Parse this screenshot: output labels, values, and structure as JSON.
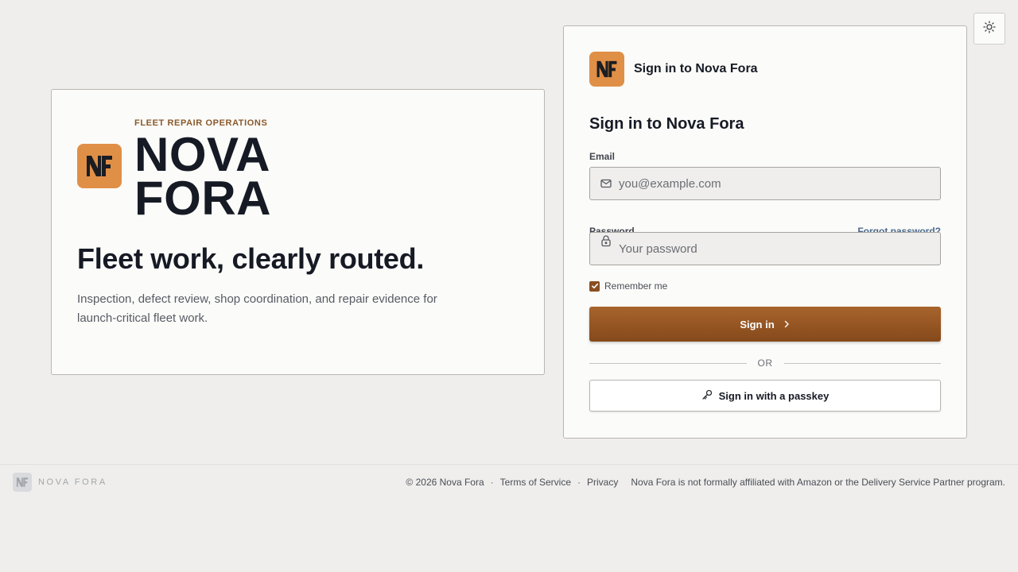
{
  "brand": {
    "eyebrow": "FLEET REPAIR OPERATIONS",
    "name_line1": "NOVA",
    "name_line2": "FORA",
    "logo_text": "NF",
    "accent_color": "#e08f47"
  },
  "hero": {
    "headline": "Fleet work, clearly routed.",
    "tagline": "Inspection, defect review, shop coordination, and repair evidence for launch-critical fleet work."
  },
  "signin": {
    "header_title": "Sign in to Nova Fora",
    "form_title": "Sign in to Nova Fora",
    "email_label": "Email",
    "email_placeholder": "you@example.com",
    "email_value": "",
    "password_label": "Password",
    "password_placeholder": "Your password",
    "password_value": "",
    "forgot_label": "Forgot password?",
    "remember_label": "Remember me",
    "remember_checked": true,
    "submit_label": "Sign in",
    "divider_label": "OR",
    "passkey_label": "Sign in with a passkey",
    "button_color": "#9a5a25"
  },
  "footer": {
    "brand_name": "NOVA FORA",
    "copyright": "© 2026 Nova Fora",
    "terms_label": "Terms of Service",
    "privacy_label": "Privacy",
    "separator": "·",
    "disclaimer": "Nova Fora is not formally affiliated with Amazon or the Delivery Service Partner program."
  },
  "icons": {
    "theme_toggle": "sun-icon",
    "email": "mail-icon",
    "password": "lock-icon",
    "submit": "chevron-right-icon",
    "passkey": "key-icon"
  }
}
